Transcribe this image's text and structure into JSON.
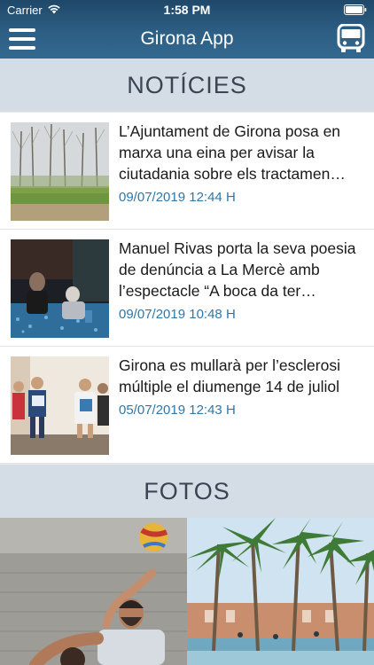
{
  "status": {
    "carrier": "Carrier",
    "time": "1:58 PM"
  },
  "nav": {
    "title": "Girona App",
    "menu_icon": "menu-icon",
    "bus_icon": "bus-icon"
  },
  "news_section": {
    "title": "NOTÍCIES",
    "items": [
      {
        "title": "L’Ajuntament de Girona posa en marxa una eina per avisar la ciutadania sobre els tractamen…",
        "date": "09/07/2019 12:44 H"
      },
      {
        "title": "Manuel Rivas porta la seva poesia de denúncia a La Mercè amb l’espectacle “A boca da ter…",
        "date": "09/07/2019 10:48 H"
      },
      {
        "title": "Girona es mullarà per l’esclerosi múltiple el diumenge 14 de juliol",
        "date": "05/07/2019 12:43 H"
      }
    ]
  },
  "photos_section": {
    "title": "FOTOS"
  },
  "colors": {
    "accent": "#2f77a8",
    "header_bg": "#d4dde6",
    "nav_bg": "#2d5e84"
  }
}
